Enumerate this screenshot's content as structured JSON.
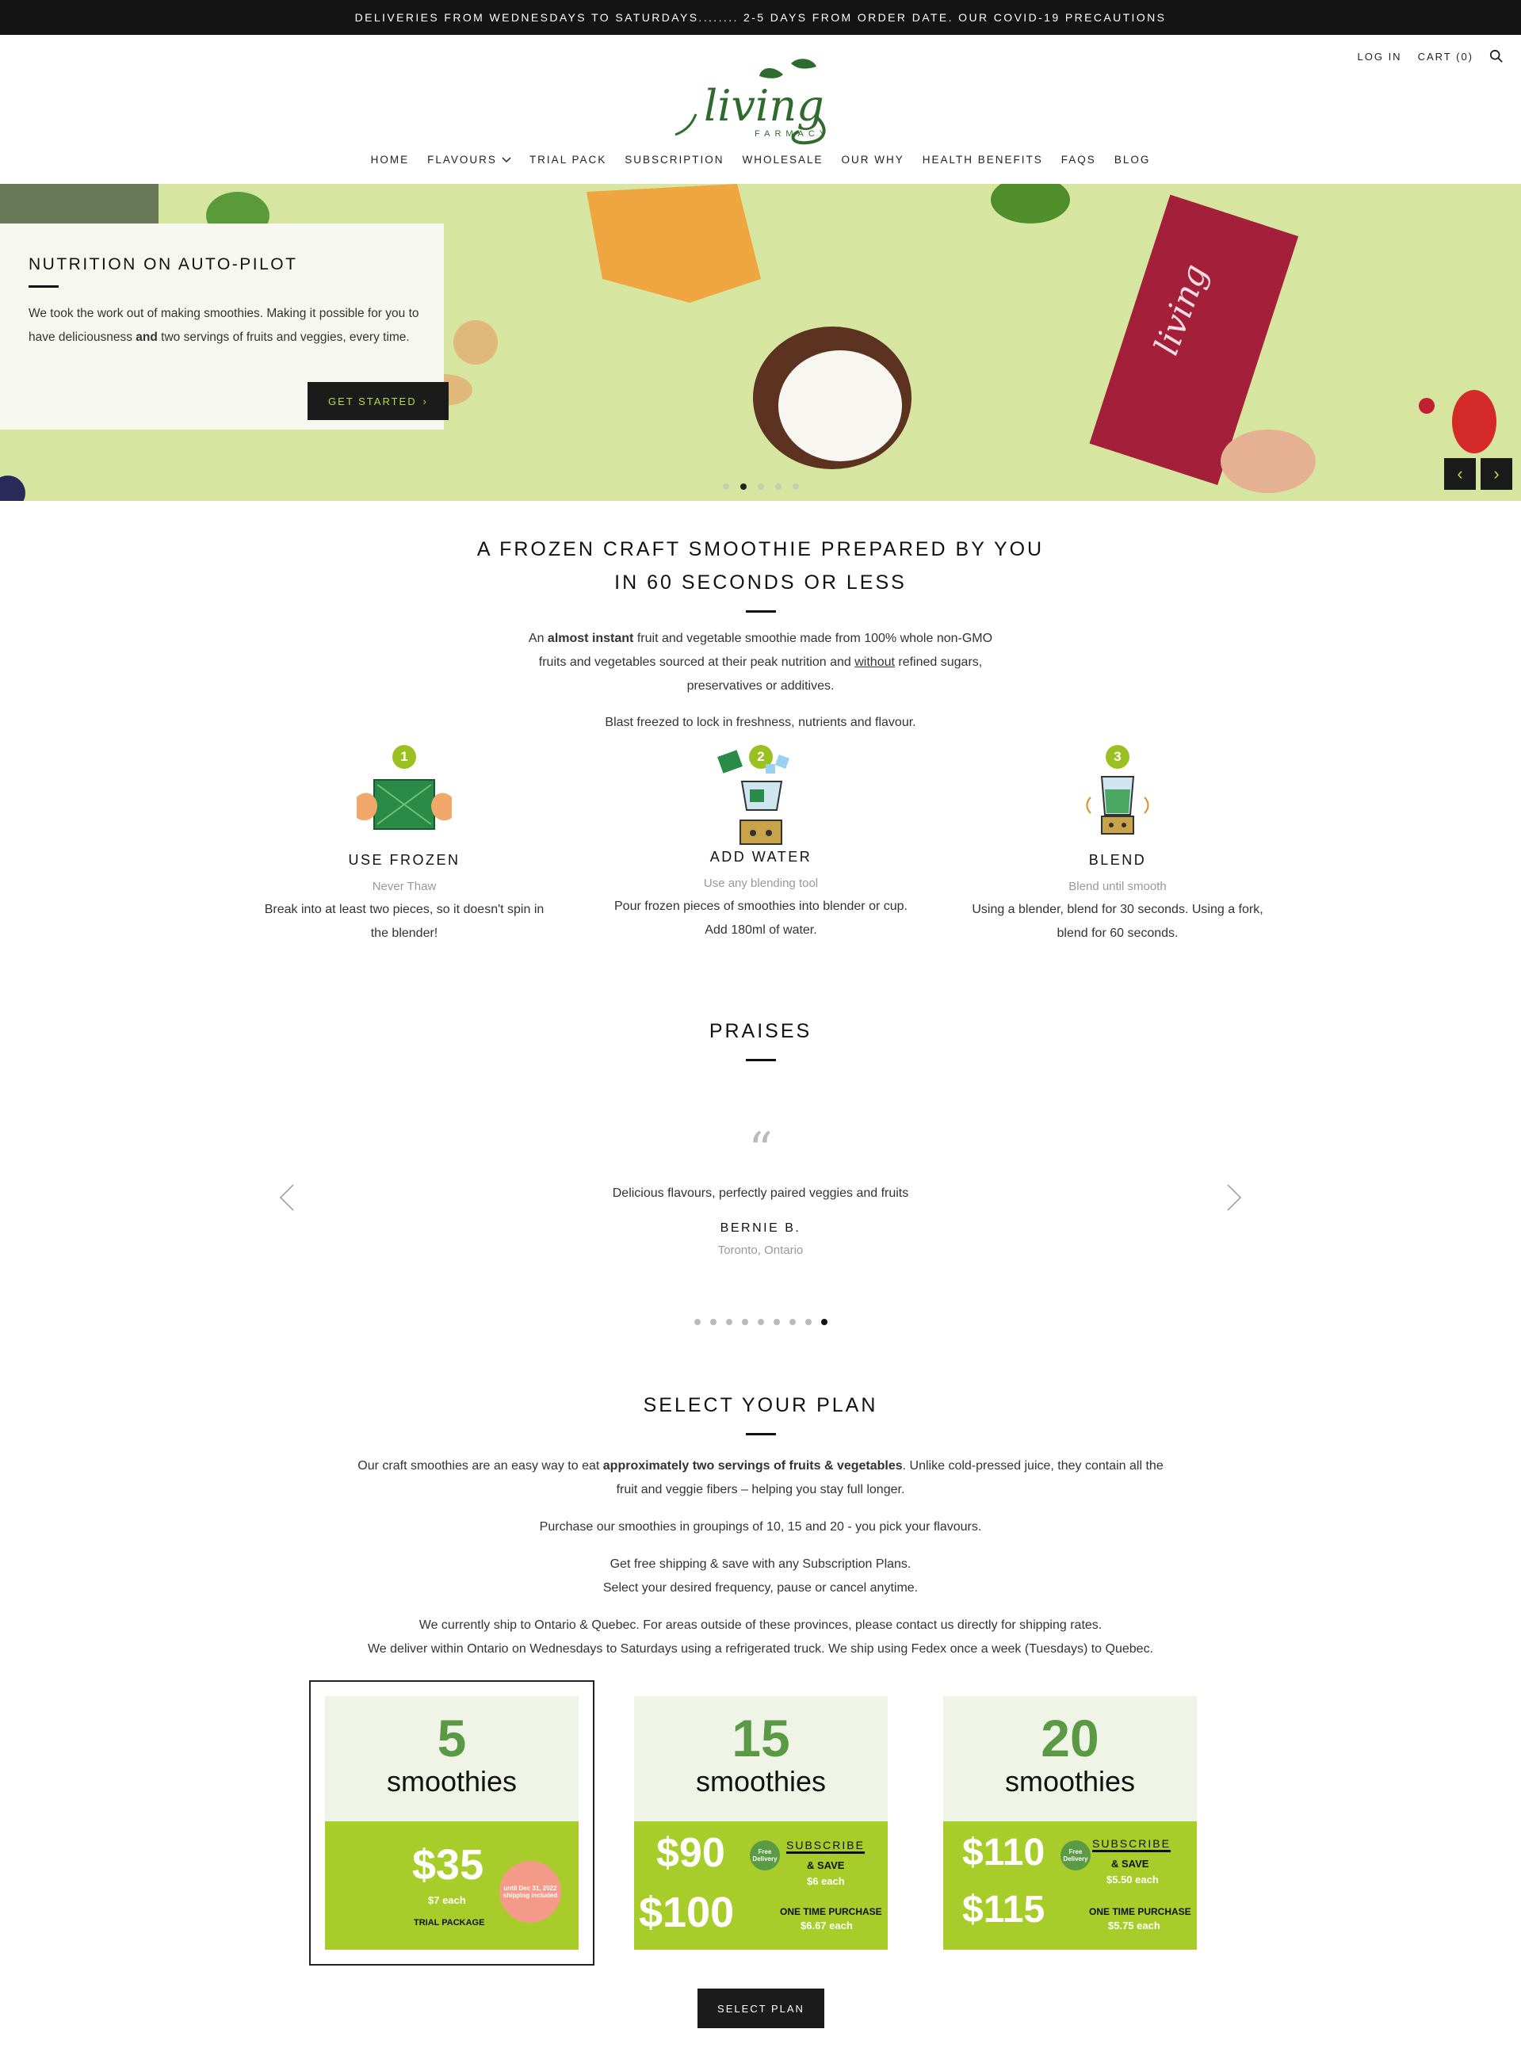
{
  "announcement": "DELIVERIES FROM WEDNESDAYS TO SATURDAYS........ 2-5 DAYS FROM ORDER DATE. OUR COVID-19 PRECAUTIONS",
  "header": {
    "login": "LOG IN",
    "cart": "CART (0)",
    "logo_text": "living",
    "logo_sub": "FARMACY",
    "nav": [
      "HOME",
      "FLAVOURS",
      "TRIAL PACK",
      "SUBSCRIPTION",
      "WHOLESALE",
      "OUR WHY",
      "HEALTH BENEFITS",
      "FAQS",
      "BLOG"
    ]
  },
  "hero": {
    "title": "NUTRITION ON AUTO-PILOT",
    "text_a": "We took the work out of making smoothies.  Making it possible for you to have deliciousness ",
    "text_bold": "and",
    "text_b": " two servings of fruits and veggies, every time.",
    "button": "GET STARTED",
    "pack_text": "living",
    "slide_count": 5,
    "active_slide": 2
  },
  "intro": {
    "title_line1": "A FROZEN CRAFT SMOOTHIE PREPARED BY YOU",
    "title_line2": "IN 60 SECONDS OR LESS",
    "p1_a": "An ",
    "p1_bold": "almost instant",
    "p1_b": " fruit and vegetable smoothie made from 100% whole non-GMO",
    "p1_c": "fruits and vegetables sourced at their peak nutrition and ",
    "p1_u": "without",
    "p1_d": " refined sugars,",
    "p1_e": "preservatives or additives.",
    "p2": "Blast freezed to lock in freshness, nutrients and flavour."
  },
  "steps": [
    {
      "num": "1",
      "title": "USE FROZEN",
      "sub": "Never Thaw",
      "desc1": "Break into at least two pieces, so it doesn't  spin in",
      "desc2": "the blender!"
    },
    {
      "num": "2",
      "title": "ADD WATER",
      "sub": "Use any blending tool",
      "desc1": "Pour frozen pieces of smoothies into blender or cup.",
      "desc2": "Add 180ml of water."
    },
    {
      "num": "3",
      "title": "BLEND",
      "sub": "Blend until smooth",
      "desc1": "Using a blender, blend for 30 seconds.  Using a fork,",
      "desc2": "blend for 60 seconds."
    }
  ],
  "praises": {
    "title": "PRAISES",
    "quote": "Delicious flavours, perfectly paired veggies and fruits",
    "author": "BERNIE B.",
    "location": "Toronto, Ontario",
    "dot_count": 9,
    "active_dot": 8
  },
  "plans_section": {
    "title": "SELECT YOUR PLAN",
    "p1_a": "Our craft smoothies are an easy way to eat ",
    "p1_bold": "approximately two servings of fruits & vegetables",
    "p1_b": ". Unlike cold-pressed juice, they contain all the",
    "p1_c": "fruit and veggie fibers – helping you stay full longer.",
    "p2": "Purchase our smoothies in groupings of 10, 15 and 20 - you pick your flavours.",
    "p3a": "Get free shipping & save with any Subscription Plans.",
    "p3b": "Select your desired frequency, pause or cancel anytime.",
    "p4a": "We currently ship to Ontario & Quebec. For areas outside of these provinces, please contact us directly for shipping rates.",
    "p4b": "We deliver within Ontario on Wednesdays to Saturdays using a refrigerated truck. We ship using Fedex once a week (Tuesdays) to Quebec.",
    "button": "SELECT PLAN"
  },
  "plans": [
    {
      "count": "5",
      "word": "smoothies",
      "price": "$35",
      "each": "$7 each",
      "label": "TRIAL PACKAGE",
      "seal": "until Dec 31, 2022 shipping included"
    },
    {
      "count": "15",
      "word": "smoothies",
      "sub_price": "$90",
      "free": "Free Delivery",
      "subscribe": "SUBSCRIBE",
      "save": "& SAVE",
      "sub_each": "$6 each",
      "otp_price": "$100",
      "otp": "ONE TIME PURCHASE",
      "otp_each": "$6.67 each"
    },
    {
      "count": "20",
      "word": "smoothies",
      "sub_price": "$110",
      "free": "Free Delivery",
      "subscribe": "SUBSCRIBE",
      "save": "& SAVE",
      "sub_each": "$5.50 each",
      "otp_price": "$115",
      "otp": "ONE TIME PURCHASE",
      "otp_each": "$5.75 each"
    }
  ],
  "colors": {
    "accent_green": "#a8cd2a",
    "dark_green": "#5a9a44",
    "dark": "#1b1b1b"
  }
}
